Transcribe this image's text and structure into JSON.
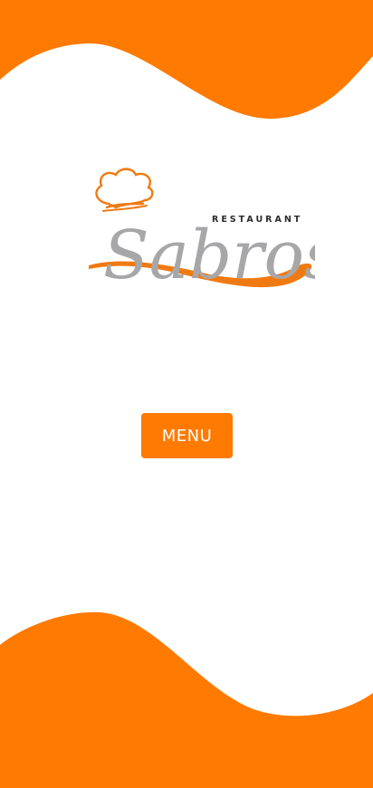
{
  "brand": {
    "logo_top_text": "RESTAURANT",
    "logo_script_text": "Sabroso",
    "logo_gray": "#a7a7a9",
    "logo_orange": "#f07a12",
    "logo_dark": "#2b2b2b"
  },
  "main": {
    "menu_button_label": "MENU"
  },
  "colors": {
    "accent": "#ff7a00",
    "background": "#ffffff"
  }
}
